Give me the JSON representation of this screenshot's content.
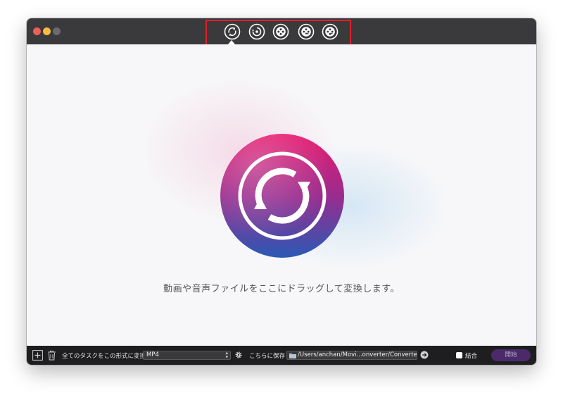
{
  "toolbar": {
    "tools": [
      {
        "icon": "convert-icon",
        "active": true
      },
      {
        "icon": "burn-dvd-icon"
      },
      {
        "icon": "film-reel-icon"
      },
      {
        "icon": "film-reel-grid-icon"
      },
      {
        "icon": "film-reel-dots-icon"
      }
    ],
    "highlight_color": "#e0202a"
  },
  "main": {
    "hero_icon": "convert-arrows-icon",
    "drop_text": "動画や音声ファイルをここにドラッグして変換します。"
  },
  "bottom": {
    "add_icon": "add-icon",
    "trash_icon": "trash-icon",
    "convert_all_label": "全てのタスクをこの形式に変換",
    "format_value": "MP4",
    "settings_icon": "gear-icon",
    "save_label": "こちらに保存",
    "output_path": "/Users/anchan/Movi...onverter/Converted",
    "merge_label": "結合",
    "start_label": "開始"
  },
  "colors": {
    "titlebar": "#3a393b",
    "bottombar": "#1e1e20",
    "hero_gradient_top": "#e8196e",
    "hero_gradient_bottom": "#2a59b5",
    "start_button": "#4b2a6a"
  }
}
